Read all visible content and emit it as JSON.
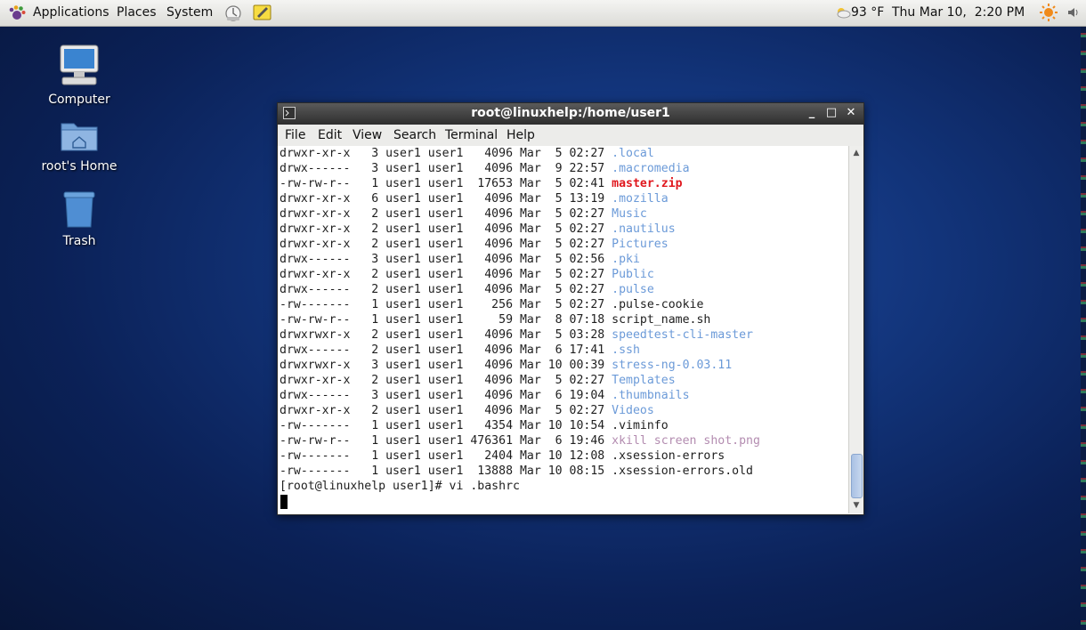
{
  "panel": {
    "menus": [
      "Applications",
      "Places",
      "System"
    ],
    "weather": "93 °F",
    "clock": "Thu Mar 10,  2:20 PM"
  },
  "desktop": {
    "icons": [
      {
        "label": "Computer"
      },
      {
        "label": "root's Home"
      },
      {
        "label": "Trash"
      }
    ]
  },
  "terminal": {
    "title": "root@linuxhelp:/home/user1",
    "menus": [
      "File",
      "Edit",
      "View",
      "Search",
      "Terminal",
      "Help"
    ],
    "lines": [
      {
        "text": "drwxr-xr-x   3 user1 user1   4096 Mar  5 02:27 ",
        "name": ".local",
        "kind": "dir"
      },
      {
        "text": "drwx------   3 user1 user1   4096 Mar  9 22:57 ",
        "name": ".macromedia",
        "kind": "dir"
      },
      {
        "text": "-rw-rw-r--   1 user1 user1  17653 Mar  5 02:41 ",
        "name": "master.zip",
        "kind": "zip"
      },
      {
        "text": "drwxr-xr-x   6 user1 user1   4096 Mar  5 13:19 ",
        "name": ".mozilla",
        "kind": "dir"
      },
      {
        "text": "drwxr-xr-x   2 user1 user1   4096 Mar  5 02:27 ",
        "name": "Music",
        "kind": "dir"
      },
      {
        "text": "drwxr-xr-x   2 user1 user1   4096 Mar  5 02:27 ",
        "name": ".nautilus",
        "kind": "dir"
      },
      {
        "text": "drwxr-xr-x   2 user1 user1   4096 Mar  5 02:27 ",
        "name": "Pictures",
        "kind": "dir"
      },
      {
        "text": "drwx------   3 user1 user1   4096 Mar  5 02:56 ",
        "name": ".pki",
        "kind": "dir"
      },
      {
        "text": "drwxr-xr-x   2 user1 user1   4096 Mar  5 02:27 ",
        "name": "Public",
        "kind": "dir"
      },
      {
        "text": "drwx------   2 user1 user1   4096 Mar  5 02:27 ",
        "name": ".pulse",
        "kind": "dir"
      },
      {
        "text": "-rw-------   1 user1 user1    256 Mar  5 02:27 ",
        "name": ".pulse-cookie",
        "kind": "file"
      },
      {
        "text": "-rw-rw-r--   1 user1 user1     59 Mar  8 07:18 ",
        "name": "script_name.sh",
        "kind": "file"
      },
      {
        "text": "drwxrwxr-x   2 user1 user1   4096 Mar  5 03:28 ",
        "name": "speedtest-cli-master",
        "kind": "dir"
      },
      {
        "text": "drwx------   2 user1 user1   4096 Mar  6 17:41 ",
        "name": ".ssh",
        "kind": "dir"
      },
      {
        "text": "drwxrwxr-x   3 user1 user1   4096 Mar 10 00:39 ",
        "name": "stress-ng-0.03.11",
        "kind": "dir"
      },
      {
        "text": "drwxr-xr-x   2 user1 user1   4096 Mar  5 02:27 ",
        "name": "Templates",
        "kind": "dir"
      },
      {
        "text": "drwx------   3 user1 user1   4096 Mar  6 19:04 ",
        "name": ".thumbnails",
        "kind": "dir"
      },
      {
        "text": "drwxr-xr-x   2 user1 user1   4096 Mar  5 02:27 ",
        "name": "Videos",
        "kind": "dir"
      },
      {
        "text": "-rw-------   1 user1 user1   4354 Mar 10 10:54 ",
        "name": ".viminfo",
        "kind": "file"
      },
      {
        "text": "-rw-rw-r--   1 user1 user1 476361 Mar  6 19:46 ",
        "name": "xkill screen shot.png",
        "kind": "img"
      },
      {
        "text": "-rw-------   1 user1 user1   2404 Mar 10 12:08 ",
        "name": ".xsession-errors",
        "kind": "file"
      },
      {
        "text": "-rw-------   1 user1 user1  13888 Mar 10 08:15 ",
        "name": ".xsession-errors.old",
        "kind": "file"
      }
    ],
    "prompt": "[root@linuxhelp user1]# vi .bashrc"
  },
  "colors": {
    "directory": "#6b9ad8",
    "archive": "#e0181e",
    "image": "#b38cb0",
    "desktop_bg": "#12347a"
  }
}
